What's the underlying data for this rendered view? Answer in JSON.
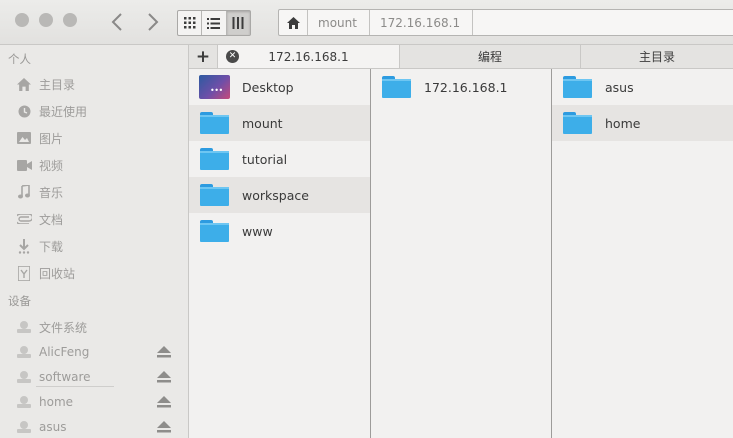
{
  "window": {
    "buttons": [
      "close",
      "minimize",
      "maximize"
    ]
  },
  "toolbar": {
    "back_icon": "chevron-left-icon",
    "forward_icon": "chevron-right-icon",
    "views": [
      {
        "name": "icon-view",
        "icon": "grid-icon",
        "active": false
      },
      {
        "name": "list-view",
        "icon": "list-icon",
        "active": false
      },
      {
        "name": "column-view",
        "icon": "columns-icon",
        "active": true
      }
    ]
  },
  "breadcrumb": {
    "home_icon": "home-icon",
    "items": [
      "mount",
      "172.16.168.1"
    ]
  },
  "sidebar": {
    "personal_heading": "个人",
    "personal": [
      {
        "label": "主目录",
        "icon": "home-icon"
      },
      {
        "label": "最近使用",
        "icon": "clock-icon"
      },
      {
        "label": "图片",
        "icon": "picture-icon"
      },
      {
        "label": "视频",
        "icon": "video-icon"
      },
      {
        "label": "音乐",
        "icon": "music-icon"
      },
      {
        "label": "文档",
        "icon": "paperclip-icon"
      },
      {
        "label": "下载",
        "icon": "download-icon"
      },
      {
        "label": "回收站",
        "icon": "trash-icon"
      }
    ],
    "devices_heading": "设备",
    "devices": [
      {
        "label": "文件系统",
        "icon": "drive-icon",
        "eject": false
      },
      {
        "label": "AlicFeng",
        "icon": "drive-icon",
        "eject": true
      },
      {
        "label": "software",
        "icon": "drive-icon",
        "eject": true
      },
      {
        "label": "home",
        "icon": "drive-icon",
        "eject": true
      },
      {
        "label": "asus",
        "icon": "drive-icon",
        "eject": true
      }
    ]
  },
  "tabs": {
    "add_label": "+",
    "items": [
      {
        "label": "172.16.168.1",
        "active": true,
        "closable": true
      },
      {
        "label": "编程",
        "active": false,
        "closable": false
      },
      {
        "label": "主目录",
        "active": false,
        "closable": false
      }
    ]
  },
  "columns": [
    {
      "items": [
        {
          "name": "Desktop",
          "type": "desktop",
          "selected": false
        },
        {
          "name": "mount",
          "type": "folder",
          "selected": true
        },
        {
          "name": "tutorial",
          "type": "folder",
          "selected": false
        },
        {
          "name": "workspace",
          "type": "folder",
          "selected": true
        },
        {
          "name": "www",
          "type": "folder",
          "selected": false
        }
      ]
    },
    {
      "items": [
        {
          "name": "172.16.168.1",
          "type": "folder",
          "selected": false
        }
      ]
    },
    {
      "items": [
        {
          "name": "asus",
          "type": "folder",
          "selected": false
        },
        {
          "name": "home",
          "type": "folder",
          "selected": true
        }
      ]
    }
  ],
  "colors": {
    "folder": "#3daee9",
    "selection": "#e6e4e2",
    "sidebar_text": "#9d9c9a"
  }
}
